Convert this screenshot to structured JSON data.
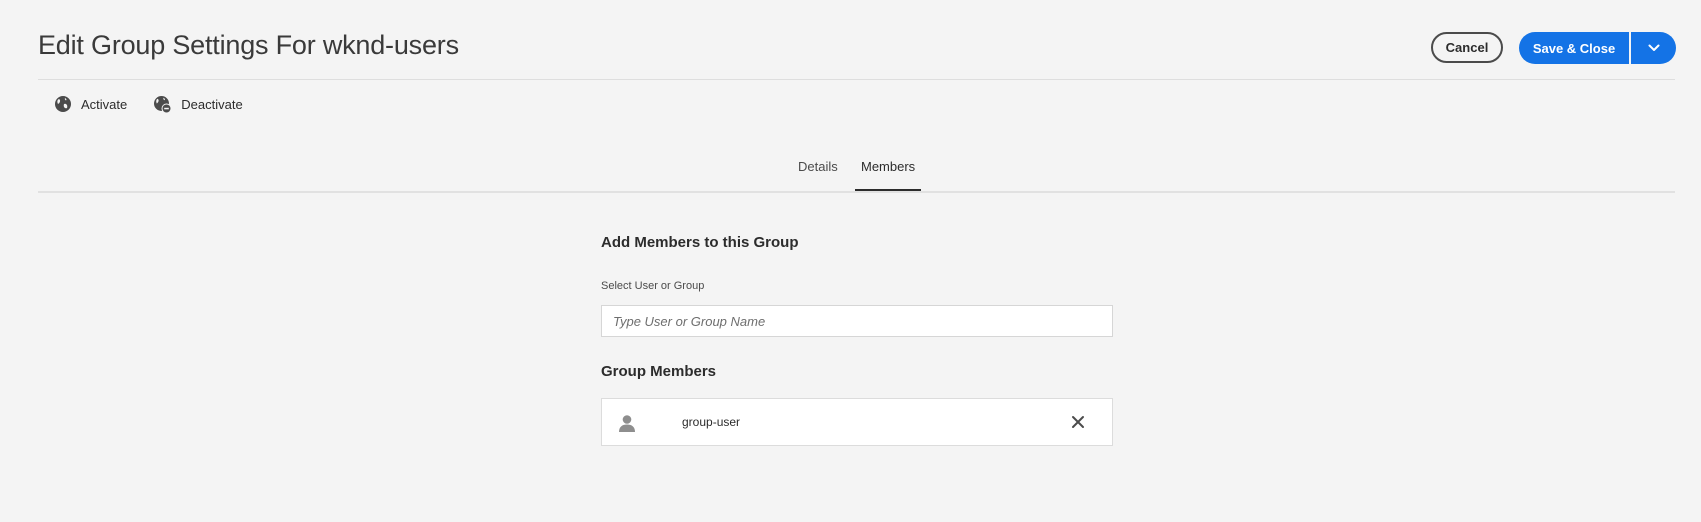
{
  "header": {
    "title": "Edit Group Settings For wknd-users",
    "cancel_label": "Cancel",
    "save_label": "Save & Close",
    "accent_color": "#1473e6"
  },
  "actions": [
    {
      "label": "Activate",
      "icon": "globe-icon"
    },
    {
      "label": "Deactivate",
      "icon": "globe-minus-icon"
    }
  ],
  "tabs": [
    {
      "label": "Details",
      "selected": false
    },
    {
      "label": "Members",
      "selected": true
    }
  ],
  "members_panel": {
    "add_title": "Add Members to this Group",
    "select_label": "Select User or Group",
    "search_placeholder": "Type User or Group Name",
    "search_value": "",
    "members_title": "Group Members",
    "members": [
      {
        "name": "group-user",
        "icon": "user-icon"
      }
    ]
  }
}
